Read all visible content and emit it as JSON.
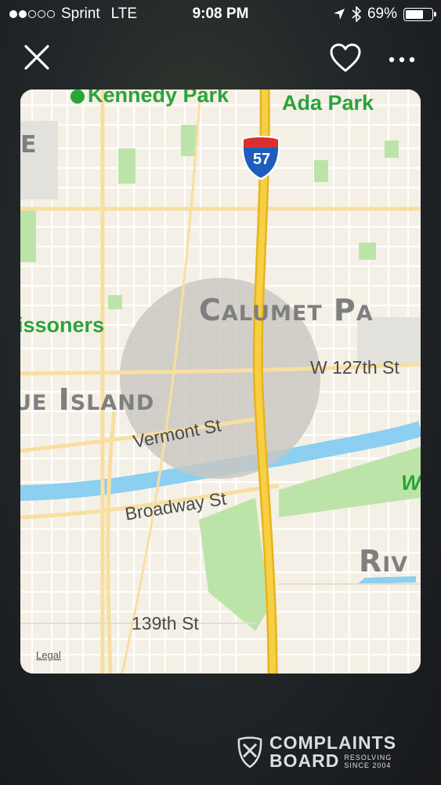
{
  "status_bar": {
    "carrier": "Sprint",
    "network": "LTE",
    "time": "9:08 PM",
    "battery_percent": "69%",
    "battery_level": 0.69,
    "signal_dots_filled": 2,
    "signal_dots_total": 5,
    "icons": [
      "location-arrow-icon",
      "bluetooth-icon",
      "battery-icon"
    ]
  },
  "toolbar": {
    "close_icon": "close-icon",
    "favorite_icon": "heart-icon",
    "more_icon": "more-dots-icon"
  },
  "map": {
    "parks": [
      "Kennedy Park",
      "Ada Park",
      "issoners"
    ],
    "places": [
      "E",
      "Calumet Pa",
      "ue Island",
      "Riv",
      "W"
    ],
    "streets": [
      "W 127th St",
      "Vermont St",
      "Broadway St",
      "139th St"
    ],
    "highway_shield": "57",
    "legal": "Legal",
    "colors": {
      "land": "#f4f0e6",
      "road": "#f8dfa0",
      "highway": "#f2c02e",
      "water": "#8ccff0",
      "park": "#bde4a8",
      "region": "#c8c6c0",
      "park_label": "#2aa43a"
    }
  },
  "watermark": {
    "line1": "COMPLAINTS",
    "line2": "BOARD",
    "tag1": "RESOLVING",
    "tag2": "SINCE 2004"
  }
}
